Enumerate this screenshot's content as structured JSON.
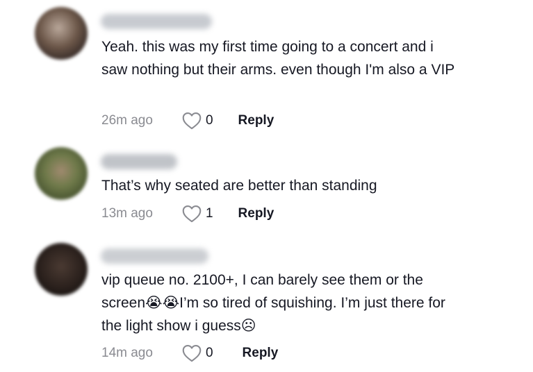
{
  "comments": [
    {
      "username": "",
      "text": "Yeah. this was my first time going to a concert and i saw nothing but their arms. even though I'm also a VIP",
      "time": "26m ago",
      "likes": "0",
      "reply_label": "Reply"
    },
    {
      "username": "",
      "text": "That’s why seated are better than standing",
      "time": "13m ago",
      "likes": "1",
      "reply_label": "Reply"
    },
    {
      "username": "",
      "text": "vip queue no. 2100+, I can barely see them or the screen😭😭I’m so tired of squishing. I’m just there for the light show i guess☹",
      "time": "14m ago",
      "likes": "0",
      "reply_label": "Reply"
    }
  ],
  "icons": {
    "like": "heart-outline-icon"
  },
  "colors": {
    "timestamp": "#8a8b91",
    "text": "#161823"
  }
}
